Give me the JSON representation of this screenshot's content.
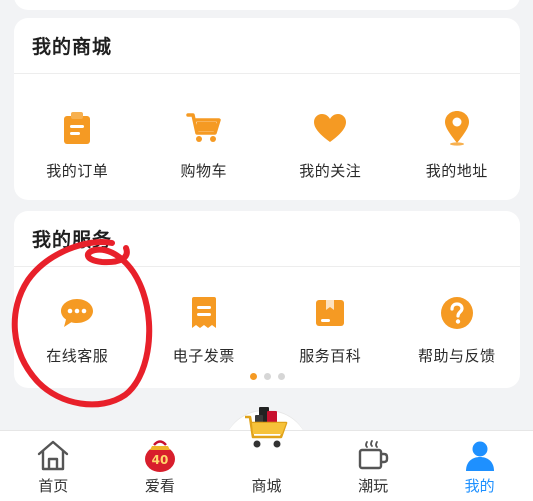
{
  "mall": {
    "title": "我的商城",
    "items": [
      {
        "label": "我的订单",
        "icon": "order-clipboard-icon"
      },
      {
        "label": "购物车",
        "icon": "shopping-cart-icon"
      },
      {
        "label": "我的关注",
        "icon": "heart-icon"
      },
      {
        "label": "我的地址",
        "icon": "location-pin-icon"
      }
    ]
  },
  "services": {
    "title": "我的服务",
    "items": [
      {
        "label": "在线客服",
        "icon": "chat-bubble-icon"
      },
      {
        "label": "电子发票",
        "icon": "invoice-icon"
      },
      {
        "label": "服务百科",
        "icon": "encyclopedia-box-icon"
      },
      {
        "label": "帮助与反馈",
        "icon": "help-question-icon"
      }
    ],
    "page_indicator": {
      "total": 3,
      "active": 1
    }
  },
  "tabbar": {
    "tabs": [
      {
        "label": "首页",
        "icon": "home-icon",
        "active": false
      },
      {
        "label": "爱看",
        "icon": "gift-bag-40-icon",
        "badge": "40",
        "active": false
      },
      {
        "label": "商城",
        "icon": "shopping-cart-mall-icon",
        "active": false
      },
      {
        "label": "潮玩",
        "icon": "coffee-cup-icon",
        "active": false
      },
      {
        "label": "我的",
        "icon": "user-profile-icon",
        "active": true
      }
    ]
  },
  "colors": {
    "accent_orange": "#f59a23",
    "active_blue": "#1e90ff",
    "annotation_red": "#e8202a",
    "background": "#f2f3f5"
  }
}
